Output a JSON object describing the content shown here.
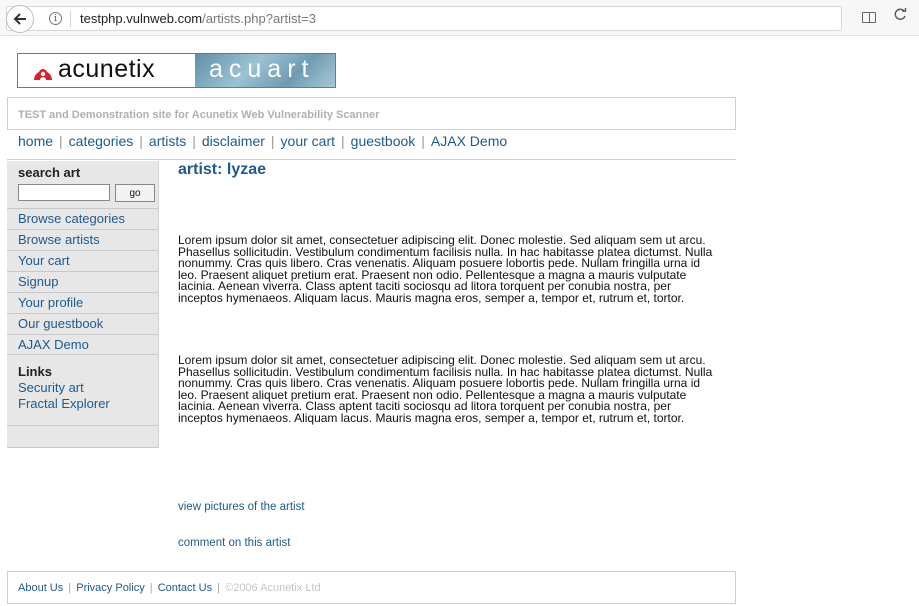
{
  "browser": {
    "url_host": "testphp.vulnweb.com",
    "url_path": "/artists.php?artist=3",
    "info_glyph": "i",
    "icons": [
      "back-arrow-icon",
      "info-icon",
      "reader-view-icon",
      "reload-icon"
    ]
  },
  "header": {
    "logo_text": "acunetix",
    "logo_sub": "acuart",
    "tagline": "TEST and Demonstration site for Acunetix Web Vulnerability Scanner"
  },
  "nav": {
    "items": [
      "home",
      "categories",
      "artists",
      "disclaimer",
      "your cart",
      "guestbook",
      "AJAX Demo"
    ]
  },
  "sidebar": {
    "search_title": "search art",
    "search_value": "",
    "go_label": "go",
    "menu": [
      "Browse categories",
      "Browse artists",
      "Your cart",
      "Signup",
      "Your profile",
      "Our guestbook",
      "AJAX Demo"
    ],
    "links_title": "Links",
    "links": [
      "Security art",
      "Fractal Explorer"
    ]
  },
  "main": {
    "title": "artist: lyzae",
    "paragraphs": [
      "Lorem ipsum dolor sit amet, consectetuer adipiscing elit. Donec molestie. Sed aliquam sem ut arcu. Phasellus sollicitudin. Vestibulum condimentum facilisis nulla. In hac habitasse platea dictumst. Nulla nonummy. Cras quis libero. Cras venenatis. Aliquam posuere lobortis pede. Nullam fringilla urna id leo. Praesent aliquet pretium erat. Praesent non odio. Pellentesque a magna a mauris vulputate lacinia. Aenean viverra. Class aptent taciti sociosqu ad litora torquent per conubia nostra, per inceptos hymenaeos. Aliquam lacus. Mauris magna eros, semper a, tempor et, rutrum et, tortor.",
      "Lorem ipsum dolor sit amet, consectetuer adipiscing elit. Donec molestie. Sed aliquam sem ut arcu. Phasellus sollicitudin. Vestibulum condimentum facilisis nulla. In hac habitasse platea dictumst. Nulla nonummy. Cras quis libero. Cras venenatis. Aliquam posuere lobortis pede. Nullam fringilla urna id leo. Praesent aliquet pretium erat. Praesent non odio. Pellentesque a magna a mauris vulputate lacinia. Aenean viverra. Class aptent taciti sociosqu ad litora torquent per conubia nostra, per inceptos hymenaeos. Aliquam lacus. Mauris magna eros, semper a, tempor et, rutrum et, tortor."
    ],
    "view_pictures_link": "view pictures of the artist",
    "comment_link": "comment on this artist"
  },
  "footer": {
    "links": [
      "About Us",
      "Privacy Policy",
      "Contact Us"
    ],
    "copyright": "©2006 Acunetix Ltd"
  },
  "colors": {
    "link": "#1d5a8f",
    "sidebar_bg": "#e7e7e7",
    "logo_red": "#d8232a"
  }
}
